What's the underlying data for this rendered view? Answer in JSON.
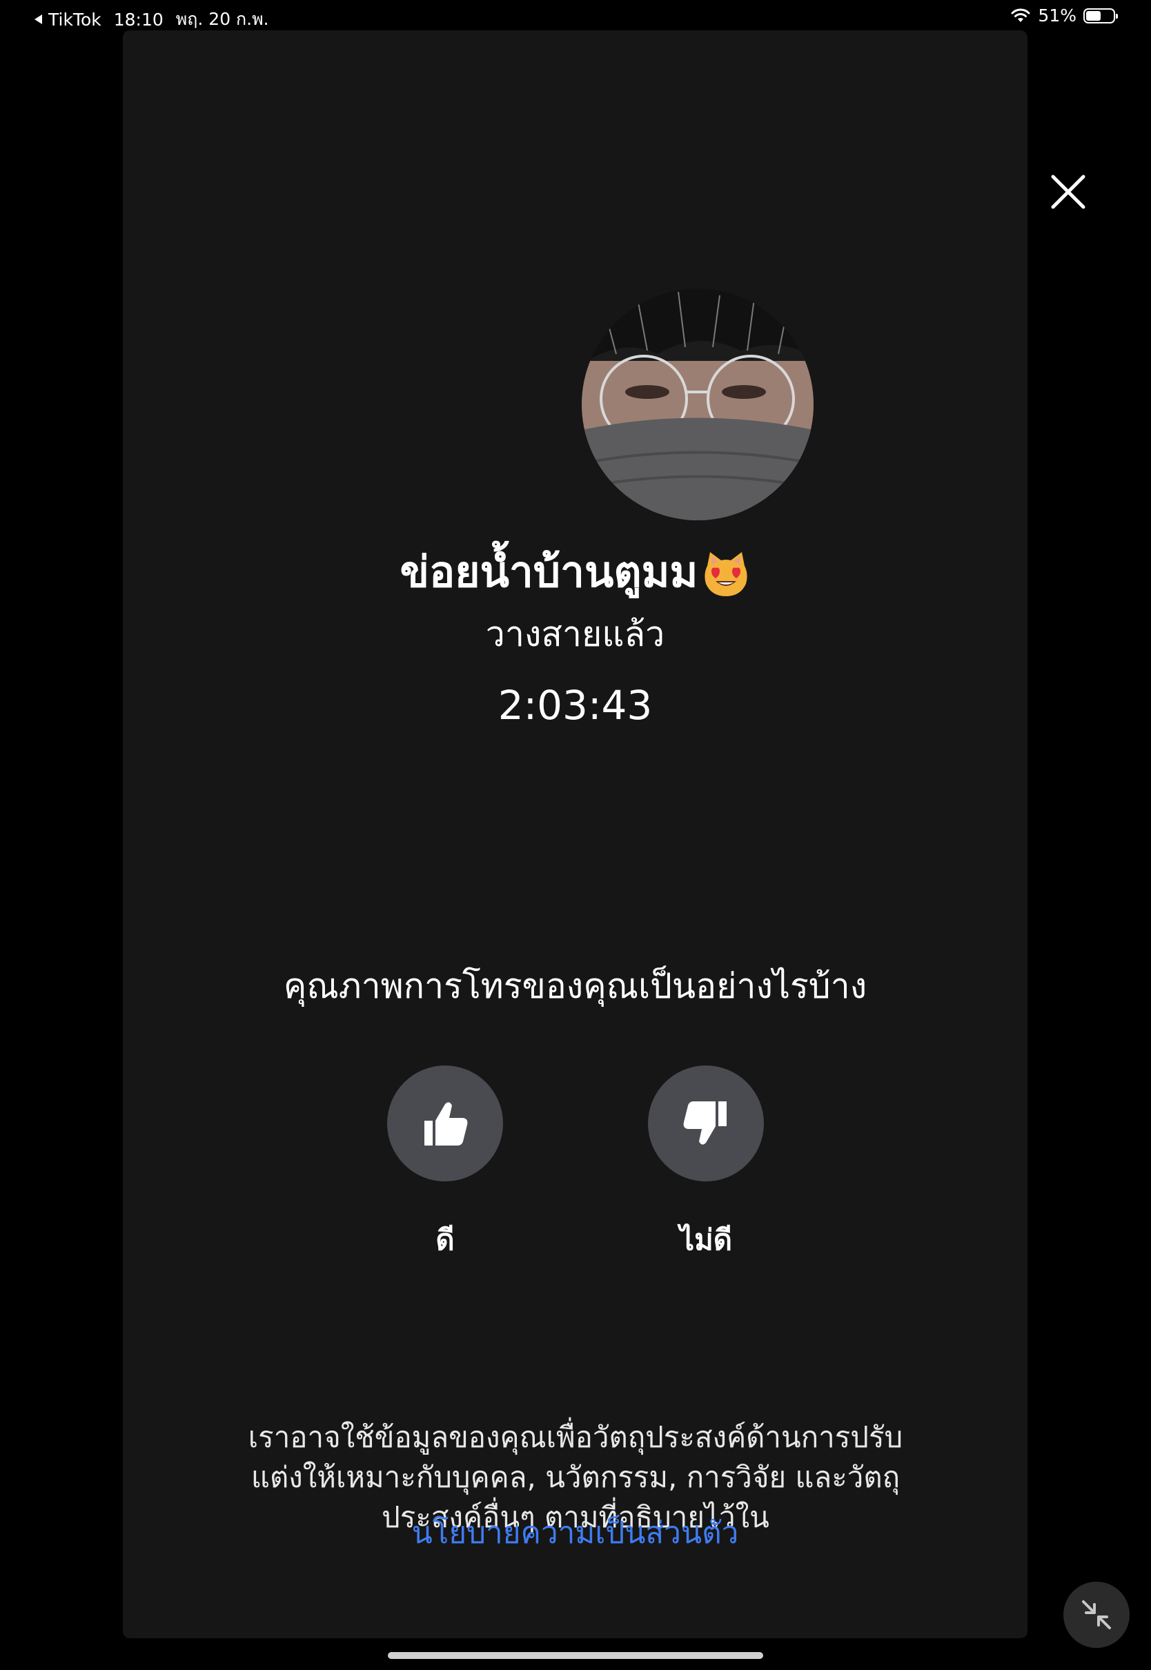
{
  "status_bar": {
    "back_app": "TikTok",
    "time": "18:10",
    "date": "พฤ. 20 ก.พ.",
    "battery": "51%",
    "battery_level": 0.51
  },
  "call": {
    "contact_name": "ข่อยน้ำบ้านตูมม",
    "contact_emoji": "smiling-cat-heart-eyes-icon",
    "status": "วางสายแล้ว",
    "duration": "2:03:43"
  },
  "feedback": {
    "question": "คุณภาพการโทรของคุณเป็นอย่างไรบ้าง",
    "good_label": "ดี",
    "bad_label": "ไม่ดี"
  },
  "disclaimer": {
    "line1": "เราอาจใช้ข้อมูลของคุณเพื่อวัตถุประสงค์ด้านการปรับ",
    "line2": "แต่งให้เหมาะกับบุคคล, นวัตกรรม, การวิจัย และวัตถุ",
    "line3": "ประสงค์อื่นๆ ตามที่อธิบายไว้ใน",
    "link": "นโยบายความเป็นส่วนตัว"
  },
  "colors": {
    "background": "#000000",
    "panel": "#161616",
    "button": "#4a4b50",
    "link": "#3f7cf2"
  }
}
